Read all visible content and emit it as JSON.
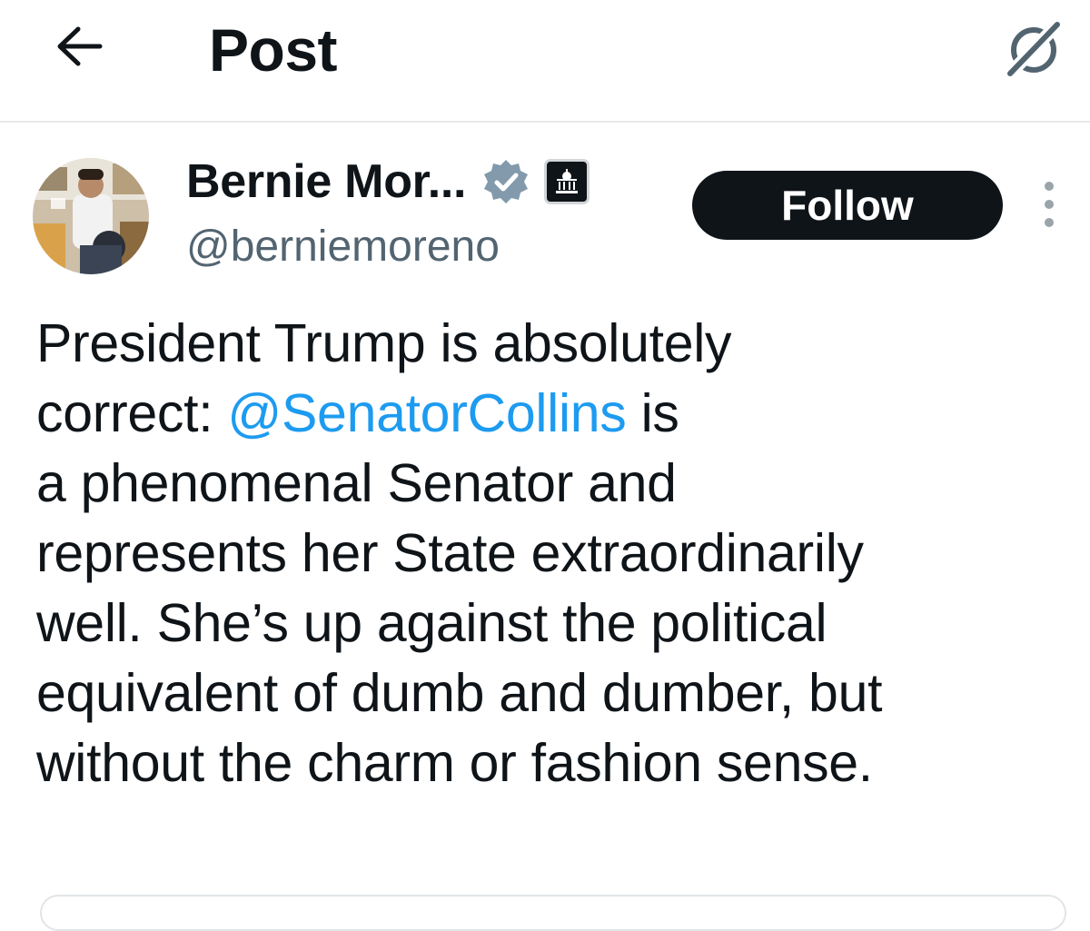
{
  "header": {
    "title": "Post",
    "back_icon": "arrow-left-icon",
    "grok_icon": "grok-icon"
  },
  "author": {
    "display_name": "Bernie Mor...",
    "handle": "@berniemoreno",
    "verified_icon": "verified-badge-icon",
    "verified_color": "#829aab",
    "affiliation_icon": "government-building-icon"
  },
  "actions": {
    "follow_label": "Follow",
    "more_icon": "more-vertical-icon"
  },
  "post": {
    "line1": "President Trump is absolutely",
    "line2_before": "correct: ",
    "mention": "@SenatorCollins",
    "line2_after": " is",
    "line3": "a phenomenal Senator and",
    "line4": "represents her State extraordinarily",
    "line5": "well. She’s up against the political",
    "line6": "equivalent of dumb and dumber, but",
    "line7": "without the charm or fashion sense."
  },
  "colors": {
    "text": "#0f1419",
    "secondary_text": "#536471",
    "link": "#1d9bf0",
    "divider": "#e7e9ea"
  }
}
